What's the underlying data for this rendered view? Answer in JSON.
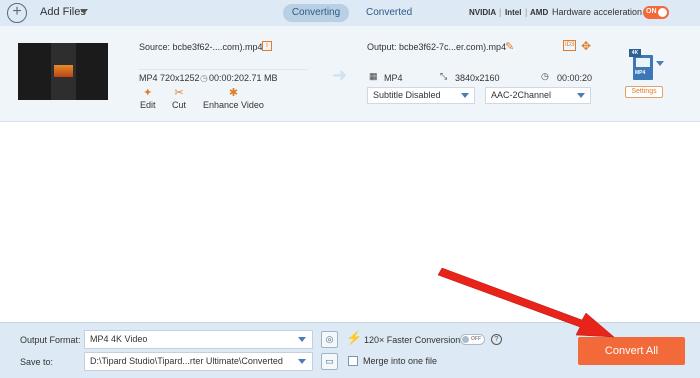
{
  "topbar": {
    "add_files_label": "Add Files",
    "tabs": [
      {
        "label": "Converting",
        "active": true
      },
      {
        "label": "Converted",
        "active": false
      }
    ],
    "hardware": {
      "vendors": [
        "NVIDIA",
        "Intel",
        "AMD"
      ],
      "label": "Hardware acceleration",
      "toggle_text": "ON"
    }
  },
  "file": {
    "source_label": "Source: bcbe3f62-....com).mp4",
    "format": "MP4",
    "resolution": "720x1252",
    "duration": "00:00:20",
    "size": "2.71 MB",
    "tools": [
      {
        "label": "Edit",
        "icon": "edit-star-icon"
      },
      {
        "label": "Cut",
        "icon": "scissors-icon"
      },
      {
        "label": "Enhance Video",
        "icon": "palette-icon"
      }
    ],
    "output_label": "Output: bcbe3f62-7c...er.com).mp4",
    "out_format": "MP4",
    "out_resolution": "3840x2160",
    "out_duration": "00:00:20",
    "subtitle_select": "Subtitle Disabled",
    "audio_select": "AAC-2Channel",
    "format_badge": "4K",
    "format_icon_text": "MP4",
    "settings_label": "Settings"
  },
  "bottom": {
    "output_format_label": "Output Format:",
    "output_format_value": "MP4 4K Video",
    "save_to_label": "Save to:",
    "save_to_value": "D:\\Tipard Studio\\Tipard...rter Ultimate\\Converted",
    "faster_label": "120× Faster Conversion",
    "faster_toggle_text": "OFF",
    "merge_label": "Merge into one file",
    "convert_all_label": "Convert All"
  },
  "colors": {
    "accent": "#f26a3a",
    "topbar_bg": "#dde9f4",
    "row_bg": "#f0f5fa",
    "annotation": "#e8231a"
  }
}
